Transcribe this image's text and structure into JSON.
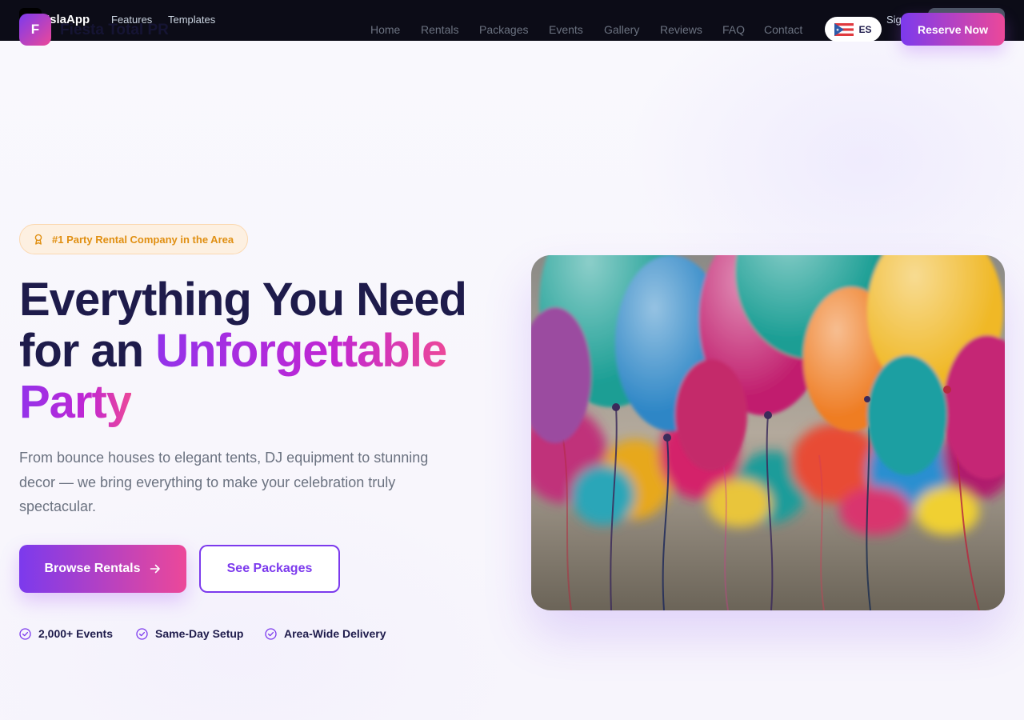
{
  "platform": {
    "name": "IslaApp",
    "links": [
      "Features",
      "Templates"
    ],
    "signin_label": "Sig"
  },
  "site": {
    "logo_letter": "F",
    "name": "Fiesta Total PR"
  },
  "nav": {
    "items": [
      "Home",
      "Rentals",
      "Packages",
      "Events",
      "Gallery",
      "Reviews",
      "FAQ",
      "Contact"
    ],
    "language": {
      "label": "ES",
      "flag_icon": "puerto-rico-flag-icon"
    },
    "cta_label": "Reserve Now"
  },
  "hero": {
    "badge": "#1 Party Rental Company in the Area",
    "title_line1": "Everything You Need",
    "title_line2_prefix": "for an ",
    "title_highlight_1": "Unforgettable",
    "title_highlight_2": "Party",
    "subtitle": "From bounce houses to elegant tents, DJ equipment to stunning decor — we bring everything to make your celebration truly spectacular.",
    "primary_button": "Browse Rentals",
    "secondary_button": "See Packages",
    "features": [
      "2,000+ Events",
      "Same-Day Setup",
      "Area-Wide Delivery"
    ],
    "image_alt": "balloons"
  },
  "colors": {
    "brand_purple": "#7c3aed",
    "brand_pink": "#ec4899",
    "navy": "#1e1b4b",
    "badge_amber": "#e08f12"
  }
}
